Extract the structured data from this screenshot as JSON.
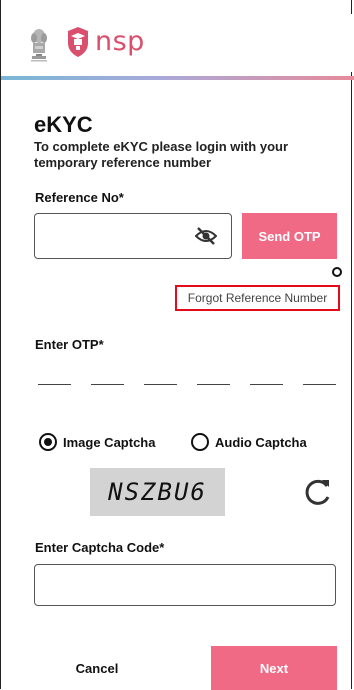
{
  "top_fragment": "",
  "header": {
    "brand": "nsp",
    "colors": {
      "brand": "#d94f6d",
      "accent": "#f06a85"
    }
  },
  "page": {
    "title": "eKYC",
    "subtitle": "To complete eKYC please login with your temporary reference number"
  },
  "reference": {
    "label": "Reference No*",
    "value": "",
    "placeholder": "",
    "send_otp_label": "Send OTP",
    "forgot_label": "Forgot Reference Number"
  },
  "otp": {
    "label": "Enter OTP*",
    "digits": [
      "",
      "",
      "",
      "",
      "",
      ""
    ]
  },
  "captcha": {
    "options": [
      {
        "label": "Image Captcha",
        "selected": true
      },
      {
        "label": "Audio Captcha",
        "selected": false
      }
    ],
    "code_image_text": "NSZBU6",
    "input_label": "Enter Captcha Code*",
    "input_value": ""
  },
  "actions": {
    "cancel_label": "Cancel",
    "next_label": "Next"
  }
}
